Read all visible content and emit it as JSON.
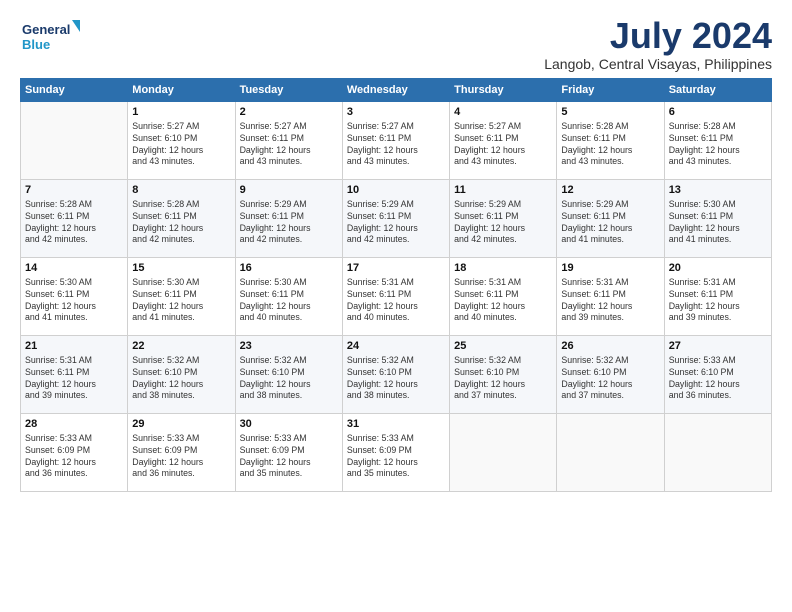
{
  "logo": {
    "line1": "General",
    "line2": "Blue"
  },
  "title": "July 2024",
  "location": "Langob, Central Visayas, Philippines",
  "weekdays": [
    "Sunday",
    "Monday",
    "Tuesday",
    "Wednesday",
    "Thursday",
    "Friday",
    "Saturday"
  ],
  "weeks": [
    [
      {
        "day": "",
        "info": ""
      },
      {
        "day": "1",
        "info": "Sunrise: 5:27 AM\nSunset: 6:10 PM\nDaylight: 12 hours\nand 43 minutes."
      },
      {
        "day": "2",
        "info": "Sunrise: 5:27 AM\nSunset: 6:11 PM\nDaylight: 12 hours\nand 43 minutes."
      },
      {
        "day": "3",
        "info": "Sunrise: 5:27 AM\nSunset: 6:11 PM\nDaylight: 12 hours\nand 43 minutes."
      },
      {
        "day": "4",
        "info": "Sunrise: 5:27 AM\nSunset: 6:11 PM\nDaylight: 12 hours\nand 43 minutes."
      },
      {
        "day": "5",
        "info": "Sunrise: 5:28 AM\nSunset: 6:11 PM\nDaylight: 12 hours\nand 43 minutes."
      },
      {
        "day": "6",
        "info": "Sunrise: 5:28 AM\nSunset: 6:11 PM\nDaylight: 12 hours\nand 43 minutes."
      }
    ],
    [
      {
        "day": "7",
        "info": "Sunrise: 5:28 AM\nSunset: 6:11 PM\nDaylight: 12 hours\nand 42 minutes."
      },
      {
        "day": "8",
        "info": "Sunrise: 5:28 AM\nSunset: 6:11 PM\nDaylight: 12 hours\nand 42 minutes."
      },
      {
        "day": "9",
        "info": "Sunrise: 5:29 AM\nSunset: 6:11 PM\nDaylight: 12 hours\nand 42 minutes."
      },
      {
        "day": "10",
        "info": "Sunrise: 5:29 AM\nSunset: 6:11 PM\nDaylight: 12 hours\nand 42 minutes."
      },
      {
        "day": "11",
        "info": "Sunrise: 5:29 AM\nSunset: 6:11 PM\nDaylight: 12 hours\nand 42 minutes."
      },
      {
        "day": "12",
        "info": "Sunrise: 5:29 AM\nSunset: 6:11 PM\nDaylight: 12 hours\nand 41 minutes."
      },
      {
        "day": "13",
        "info": "Sunrise: 5:30 AM\nSunset: 6:11 PM\nDaylight: 12 hours\nand 41 minutes."
      }
    ],
    [
      {
        "day": "14",
        "info": "Sunrise: 5:30 AM\nSunset: 6:11 PM\nDaylight: 12 hours\nand 41 minutes."
      },
      {
        "day": "15",
        "info": "Sunrise: 5:30 AM\nSunset: 6:11 PM\nDaylight: 12 hours\nand 41 minutes."
      },
      {
        "day": "16",
        "info": "Sunrise: 5:30 AM\nSunset: 6:11 PM\nDaylight: 12 hours\nand 40 minutes."
      },
      {
        "day": "17",
        "info": "Sunrise: 5:31 AM\nSunset: 6:11 PM\nDaylight: 12 hours\nand 40 minutes."
      },
      {
        "day": "18",
        "info": "Sunrise: 5:31 AM\nSunset: 6:11 PM\nDaylight: 12 hours\nand 40 minutes."
      },
      {
        "day": "19",
        "info": "Sunrise: 5:31 AM\nSunset: 6:11 PM\nDaylight: 12 hours\nand 39 minutes."
      },
      {
        "day": "20",
        "info": "Sunrise: 5:31 AM\nSunset: 6:11 PM\nDaylight: 12 hours\nand 39 minutes."
      }
    ],
    [
      {
        "day": "21",
        "info": "Sunrise: 5:31 AM\nSunset: 6:11 PM\nDaylight: 12 hours\nand 39 minutes."
      },
      {
        "day": "22",
        "info": "Sunrise: 5:32 AM\nSunset: 6:10 PM\nDaylight: 12 hours\nand 38 minutes."
      },
      {
        "day": "23",
        "info": "Sunrise: 5:32 AM\nSunset: 6:10 PM\nDaylight: 12 hours\nand 38 minutes."
      },
      {
        "day": "24",
        "info": "Sunrise: 5:32 AM\nSunset: 6:10 PM\nDaylight: 12 hours\nand 38 minutes."
      },
      {
        "day": "25",
        "info": "Sunrise: 5:32 AM\nSunset: 6:10 PM\nDaylight: 12 hours\nand 37 minutes."
      },
      {
        "day": "26",
        "info": "Sunrise: 5:32 AM\nSunset: 6:10 PM\nDaylight: 12 hours\nand 37 minutes."
      },
      {
        "day": "27",
        "info": "Sunrise: 5:33 AM\nSunset: 6:10 PM\nDaylight: 12 hours\nand 36 minutes."
      }
    ],
    [
      {
        "day": "28",
        "info": "Sunrise: 5:33 AM\nSunset: 6:09 PM\nDaylight: 12 hours\nand 36 minutes."
      },
      {
        "day": "29",
        "info": "Sunrise: 5:33 AM\nSunset: 6:09 PM\nDaylight: 12 hours\nand 36 minutes."
      },
      {
        "day": "30",
        "info": "Sunrise: 5:33 AM\nSunset: 6:09 PM\nDaylight: 12 hours\nand 35 minutes."
      },
      {
        "day": "31",
        "info": "Sunrise: 5:33 AM\nSunset: 6:09 PM\nDaylight: 12 hours\nand 35 minutes."
      },
      {
        "day": "",
        "info": ""
      },
      {
        "day": "",
        "info": ""
      },
      {
        "day": "",
        "info": ""
      }
    ]
  ]
}
